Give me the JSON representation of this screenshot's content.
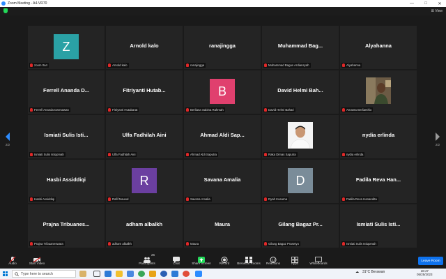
{
  "window": {
    "title": "Zoom Meeting - A4-VR70",
    "minimize": "—",
    "maximize": "□",
    "close": "✕"
  },
  "view_button": "⊞ View",
  "pager": {
    "left": "2/2",
    "right": "2/2"
  },
  "participants": [
    {
      "display": "",
      "label": "zoom 0a4",
      "avatar": {
        "letter": "Z",
        "color": "#2aa1a5"
      }
    },
    {
      "display": "Arnold kalo",
      "label": "Arnold kalo"
    },
    {
      "display": "ranajingga",
      "label": "ranajingga"
    },
    {
      "display": "Muhammad Bag...",
      "label": "Muhammad Bagus Ardiansyah"
    },
    {
      "display": "Alyahanna",
      "label": "Alyahanna"
    },
    {
      "display": "Ferrell Ananda D...",
      "label": "Ferrell Ananda Darmawan"
    },
    {
      "display": "Fitriyanti Hutab...",
      "label": "Fitriyanti Hutabarat"
    },
    {
      "display": "",
      "label": "Berliana Sabina Rahmah",
      "avatar": {
        "letter": "B",
        "color": "#e0406e"
      }
    },
    {
      "display": "David Helmi Bah...",
      "label": "David Helmi Bahari"
    },
    {
      "display": "",
      "label": "Amanta Berlianthio",
      "photo": "room"
    },
    {
      "display": "Ismiati Sulis Isti...",
      "label": "Ismiati Sulis Istiqomah"
    },
    {
      "display": "Ulfa Fadhilah Aini",
      "label": "Ulfa Fadhilah Aini"
    },
    {
      "display": "Ahmad Aldi Sap...",
      "label": "Ahmad Aldi Saputra"
    },
    {
      "display": "",
      "label": "Raka Dimas Saputra",
      "photo": "person"
    },
    {
      "display": "nydia erlinda",
      "label": "nydia erlinda"
    },
    {
      "display": "Hasbi Assiddiqi",
      "label": "Hasbi Assiddiqi"
    },
    {
      "display": "",
      "label": "Rafif Nauval",
      "avatar": {
        "letter": "R",
        "color": "#6b3fa0"
      }
    },
    {
      "display": "Savana Amalia",
      "label": "Savana Amalia"
    },
    {
      "display": "",
      "label": "Dyah Kusuma",
      "avatar": {
        "letter": "D",
        "color": "#7a8c99"
      }
    },
    {
      "display": "Fadila Reva Han...",
      "label": "Fadila Reva Hanandita"
    },
    {
      "display": "Prajna Tribuanes...",
      "label": "Prajna Tribuaneswara"
    },
    {
      "display": "adham albalkh",
      "label": "adham albalkh"
    },
    {
      "display": "Maura",
      "label": "Maura"
    },
    {
      "display": "Gilang Bagaz Pr...",
      "label": "Gilang Bagaz Prasetyo"
    },
    {
      "display": "Ismiati Sulis Isti...",
      "label": "Ismiati Sulis Istiqomah"
    }
  ],
  "toolbar": {
    "audio": "Audio",
    "start_video": "Start Video",
    "participants": "Participants",
    "participants_count": "26",
    "chat": "Chat",
    "share_screen": "Share Screen",
    "record": "Record",
    "breakout_rooms": "Breakout Rooms",
    "reactions": "Reactions",
    "apps": "Apps",
    "whiteboards": "Whiteboards",
    "leave_room": "Leave Room"
  },
  "colors": {
    "share_green": "#23d959",
    "leave_blue": "#0e72ed",
    "mute_red": "#e02828",
    "pager_blue": "#2d8cff"
  },
  "taskbar": {
    "search_placeholder": "Type here to search",
    "weather": "31°C Berawan",
    "time": "18:47",
    "date": "05/25/2023"
  }
}
